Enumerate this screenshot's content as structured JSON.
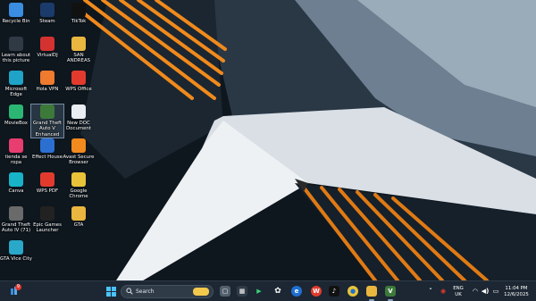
{
  "desktop": {
    "icons": [
      {
        "label": "Recycle Bin",
        "icon": "recycle-bin-icon",
        "color": "#3a8de0"
      },
      {
        "label": "Steam",
        "icon": "steam-icon",
        "color": "#1b3b6b"
      },
      {
        "label": "TikTok",
        "icon": "tiktok-icon",
        "color": "#111111"
      },
      {
        "label": "Learn about this picture",
        "icon": "learn-about-picture-icon",
        "color": "#303a44"
      },
      {
        "label": "VirtualDJ",
        "icon": "virtualdj-icon",
        "color": "#d43131"
      },
      {
        "label": "SAN ANDREAS",
        "icon": "folder-icon",
        "color": "#e9b640"
      },
      {
        "label": "Microsoft Edge",
        "icon": "edge-icon",
        "color": "#1fa3c7"
      },
      {
        "label": "Hola VPN",
        "icon": "hola-vpn-icon",
        "color": "#f07a2e"
      },
      {
        "label": "WPS Office",
        "icon": "wps-office-icon",
        "color": "#e23b2e"
      },
      {
        "label": "MovieBox",
        "icon": "moviebox-icon",
        "color": "#2bb673"
      },
      {
        "label": "Grand Theft Auto V Enhanced",
        "icon": "gta-v-icon",
        "color": "#3d7a3a"
      },
      {
        "label": "New DOC Document",
        "icon": "document-icon",
        "color": "#e9eef3"
      },
      {
        "label": "tienda se ropa",
        "icon": "colorful-file-icon",
        "color": "#e83d6f"
      },
      {
        "label": "Effect House",
        "icon": "effect-house-icon",
        "color": "#2b6fd1"
      },
      {
        "label": "Avast Secure Browser",
        "icon": "avast-browser-icon",
        "color": "#f28a1e"
      },
      {
        "label": "Canva",
        "icon": "canva-icon",
        "color": "#18b3c7"
      },
      {
        "label": "WPS PDF",
        "icon": "wps-pdf-icon",
        "color": "#e23b2e"
      },
      {
        "label": "Google Chrome",
        "icon": "chrome-icon",
        "color": "#e8c33a"
      },
      {
        "label": "Grand Theft Auto IV (71)",
        "icon": "gta-iv-icon",
        "color": "#6a6a6a"
      },
      {
        "label": "Epic Games Launcher",
        "icon": "epic-games-icon",
        "color": "#222222"
      },
      {
        "label": "GTA",
        "icon": "folder-icon",
        "color": "#e9b640"
      },
      {
        "label": "GTA Vice City",
        "icon": "gta-vice-city-icon",
        "color": "#2aa8c9"
      }
    ]
  },
  "taskbar": {
    "search_placeholder": "Search",
    "notification_count": "9",
    "apps": [
      {
        "name": "start-button",
        "icon": "windows-icon"
      },
      {
        "name": "task-view-button",
        "icon": "task-view-icon"
      },
      {
        "name": "widgets-app",
        "icon": "widgets-icon"
      },
      {
        "name": "file-explorer-app",
        "icon": "file-explorer-icon"
      },
      {
        "name": "store-app",
        "icon": "store-icon"
      },
      {
        "name": "chatgpt-app",
        "icon": "chatgpt-icon"
      },
      {
        "name": "edge-app",
        "icon": "edge-icon"
      },
      {
        "name": "wps-app",
        "icon": "wps-icon"
      },
      {
        "name": "tiktok-app",
        "icon": "tiktok-icon"
      },
      {
        "name": "chrome-app",
        "icon": "chrome-icon"
      },
      {
        "name": "folder-app",
        "icon": "folder-icon"
      },
      {
        "name": "gta-app",
        "icon": "gta-icon"
      }
    ],
    "tray": {
      "language": "ENG",
      "region": "UK",
      "time": "11:04 PM",
      "date": "12/6/2025"
    }
  },
  "colors": {
    "taskbar_bg": "#1c2733",
    "accent_orange": "#f08a1c",
    "wallpaper_dark": "#0d141b"
  }
}
